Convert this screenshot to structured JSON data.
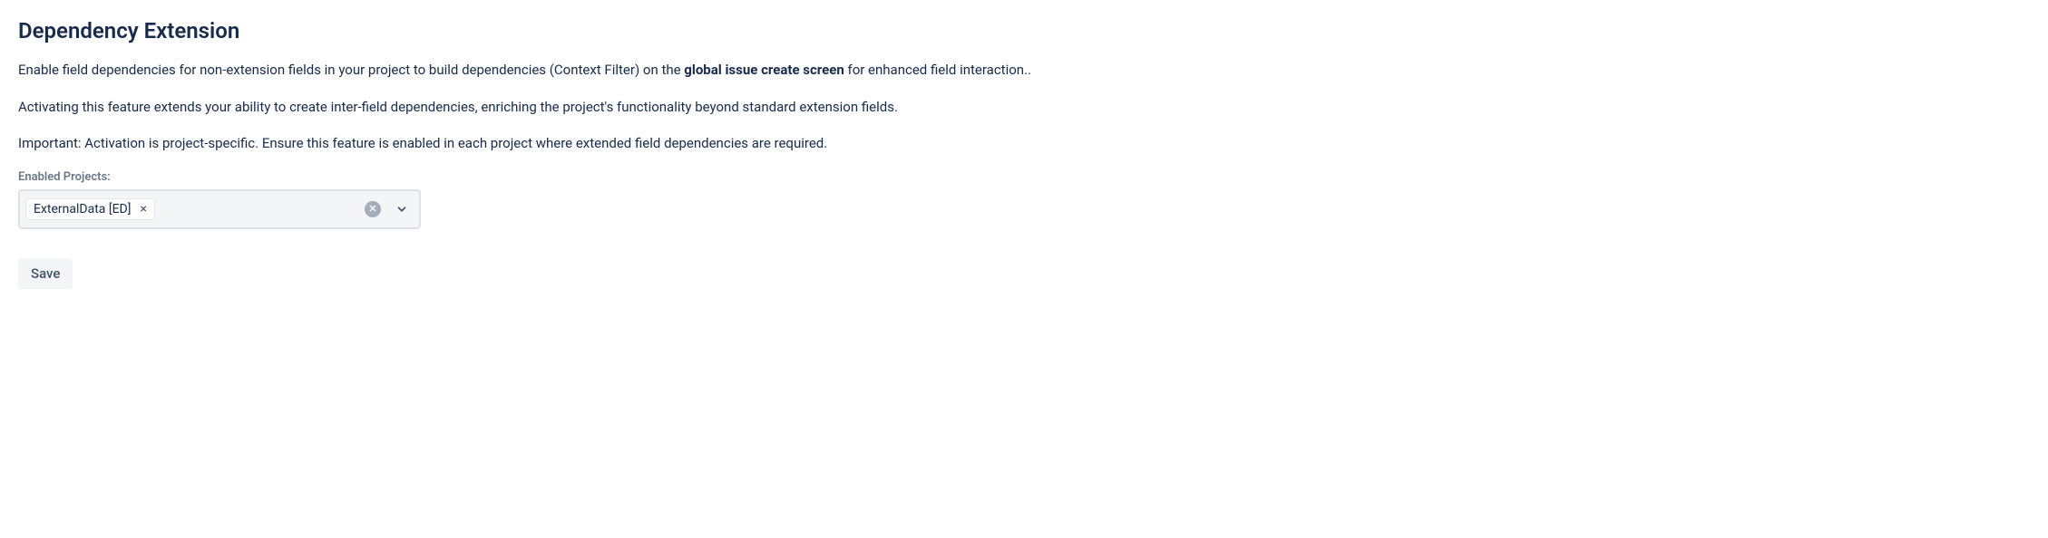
{
  "header": {
    "title": "Dependency Extension"
  },
  "description": {
    "para1_pre": "Enable field dependencies for non-extension fields in your project to build dependencies (Context Filter) on the ",
    "para1_bold": "global issue create screen",
    "para1_post": " for enhanced field interaction..",
    "para2": "Activating this feature extends your ability to create inter-field dependencies, enriching the project's functionality beyond standard extension fields.",
    "para3": "Important: Activation is project-specific. Ensure this feature is enabled in each project where extended field dependencies are required."
  },
  "form": {
    "enabled_projects_label": "Enabled Projects:",
    "selected_projects": [
      {
        "label": "ExternalData [ED]"
      }
    ],
    "tag_remove_glyph": "×",
    "clear_glyph": "✕",
    "save_label": "Save"
  }
}
